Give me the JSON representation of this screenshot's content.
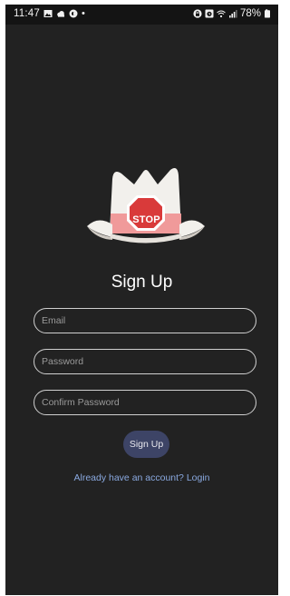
{
  "status_bar": {
    "time": "11:47",
    "separator": "•",
    "battery": "78%",
    "left_icons": [
      "gallery-icon",
      "cloud-icon",
      "brightness-icon"
    ],
    "right_icons": [
      "lock-icon",
      "alarm-icon",
      "wifi-icon",
      "signal-icon",
      "battery-icon"
    ]
  },
  "logo": {
    "sign_text": "STOP",
    "icon": "stop-sign-hat-logo"
  },
  "title": "Sign Up",
  "form": {
    "email_placeholder": "Email",
    "password_placeholder": "Password",
    "confirm_password_placeholder": "Confirm Password",
    "submit_label": "Sign Up"
  },
  "login_link": "Already have an account? Login",
  "colors": {
    "background": "#222222",
    "button": "#3d4466",
    "link": "#8aa9e0",
    "stop_red": "#d93a3a",
    "hat_band": "#f09a9a"
  }
}
